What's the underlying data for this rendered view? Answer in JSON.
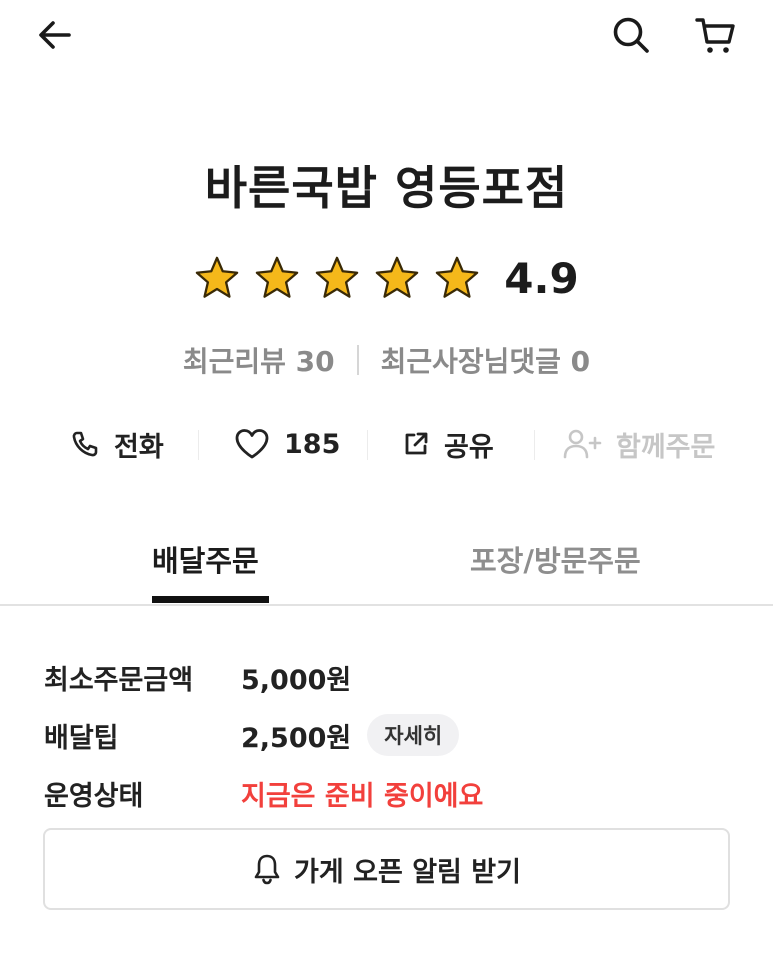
{
  "top_bar": {
    "back_icon": "arrow-left-icon",
    "search_icon": "search-icon",
    "cart_icon": "cart-icon"
  },
  "store": {
    "name": "바른국밥 영등포점",
    "rating": "4.9",
    "rating_stars": 5,
    "recent_reviews": "최근리뷰 30",
    "owner_replies": "최근사장님댓글 0"
  },
  "actions": {
    "call_label": "전화",
    "like_count": "185",
    "share_label": "공유",
    "together_label": "함께주문"
  },
  "tabs": [
    {
      "label": "배달주문",
      "active": true
    },
    {
      "label": "포장/방문주문",
      "active": false
    }
  ],
  "info": {
    "min_order_label": "최소주문금액",
    "min_order_value": "5,000원",
    "delivery_tip_label": "배달팁",
    "delivery_tip_value": "2,500원",
    "detail_label": "자세히",
    "status_label": "운영상태",
    "status_value": "지금은 준비 중이에요"
  },
  "notify_button": {
    "label": "가게 오픈 알림 받기"
  },
  "colors": {
    "accent_red": "#f2403c",
    "star": "#f5b81a"
  }
}
